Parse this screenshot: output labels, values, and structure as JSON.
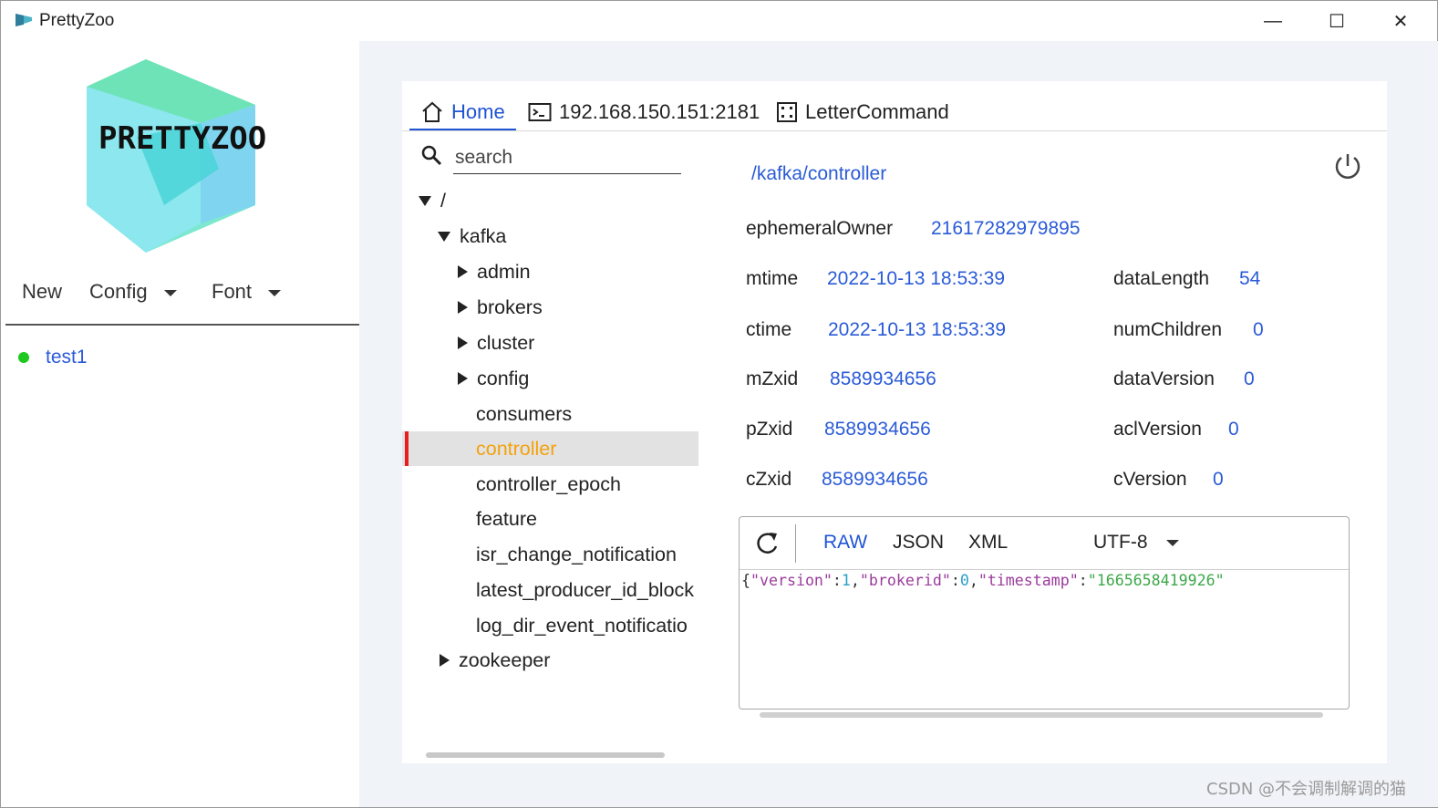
{
  "window": {
    "title": "PrettyZoo",
    "minimize_glyph": "—",
    "maximize_glyph": "☐",
    "close_glyph": "✕"
  },
  "logo": {
    "text": "PRETTYZOO"
  },
  "menu": {
    "new_label": "New",
    "config_label": "Config",
    "font_label": "Font"
  },
  "servers": [
    {
      "name": "test1",
      "status_color": "#1cc91c"
    }
  ],
  "tabs": {
    "home": "Home",
    "server": "192.168.150.151:2181",
    "letter_command": "LetterCommand"
  },
  "search": {
    "placeholder": "search"
  },
  "tree": {
    "root": "/",
    "kafka": "kafka",
    "children": [
      "admin",
      "brokers",
      "cluster",
      "config",
      "consumers",
      "controller",
      "controller_epoch",
      "feature",
      "isr_change_notification",
      "latest_producer_id_block",
      "log_dir_event_notificatio"
    ],
    "zookeeper": "zookeeper"
  },
  "node": {
    "path": "/kafka/controller",
    "ephemeralOwner": {
      "label": "ephemeralOwner",
      "value": "216172829798​95"
    },
    "mtime": {
      "label": "mtime",
      "value": "2022-10-13 18:53:39"
    },
    "ctime": {
      "label": "ctime",
      "value": "2022-10-13 18:53:39"
    },
    "mZxid": {
      "label": "mZxid",
      "value": "8589934656"
    },
    "pZxid": {
      "label": "pZxid",
      "value": "8589934656"
    },
    "cZxid": {
      "label": "cZxid",
      "value": "8589934656"
    },
    "dataLength": {
      "label": "dataLength",
      "value": "54"
    },
    "numChildren": {
      "label": "numChildren",
      "value": "0"
    },
    "dataVersion": {
      "label": "dataVersion",
      "value": "0"
    },
    "aclVersion": {
      "label": "aclVersion",
      "value": "0"
    },
    "cVersion": {
      "label": "cVersion",
      "value": "0"
    }
  },
  "editor": {
    "formats": [
      "RAW",
      "JSON",
      "XML"
    ],
    "active_format": "RAW",
    "charset": "UTF-8",
    "content": {
      "open": "{",
      "k1": "\"version\"",
      "c1": ":",
      "v1": "1",
      "s1": ",",
      "k2": "\"brokerid\"",
      "c2": ":",
      "v2": "0",
      "s2": ",",
      "k3": "\"timestamp\"",
      "c3": ":",
      "v3": "\"1665658419926\"",
      "close": "}"
    }
  },
  "watermark": "CSDN @不会调制解调的猫",
  "colors": {
    "accent": "#1f54d6",
    "link": "#2a5bd7",
    "selected_text": "#f4a20d",
    "selected_bar": "#e8201c",
    "status_online": "#1cc91c"
  }
}
